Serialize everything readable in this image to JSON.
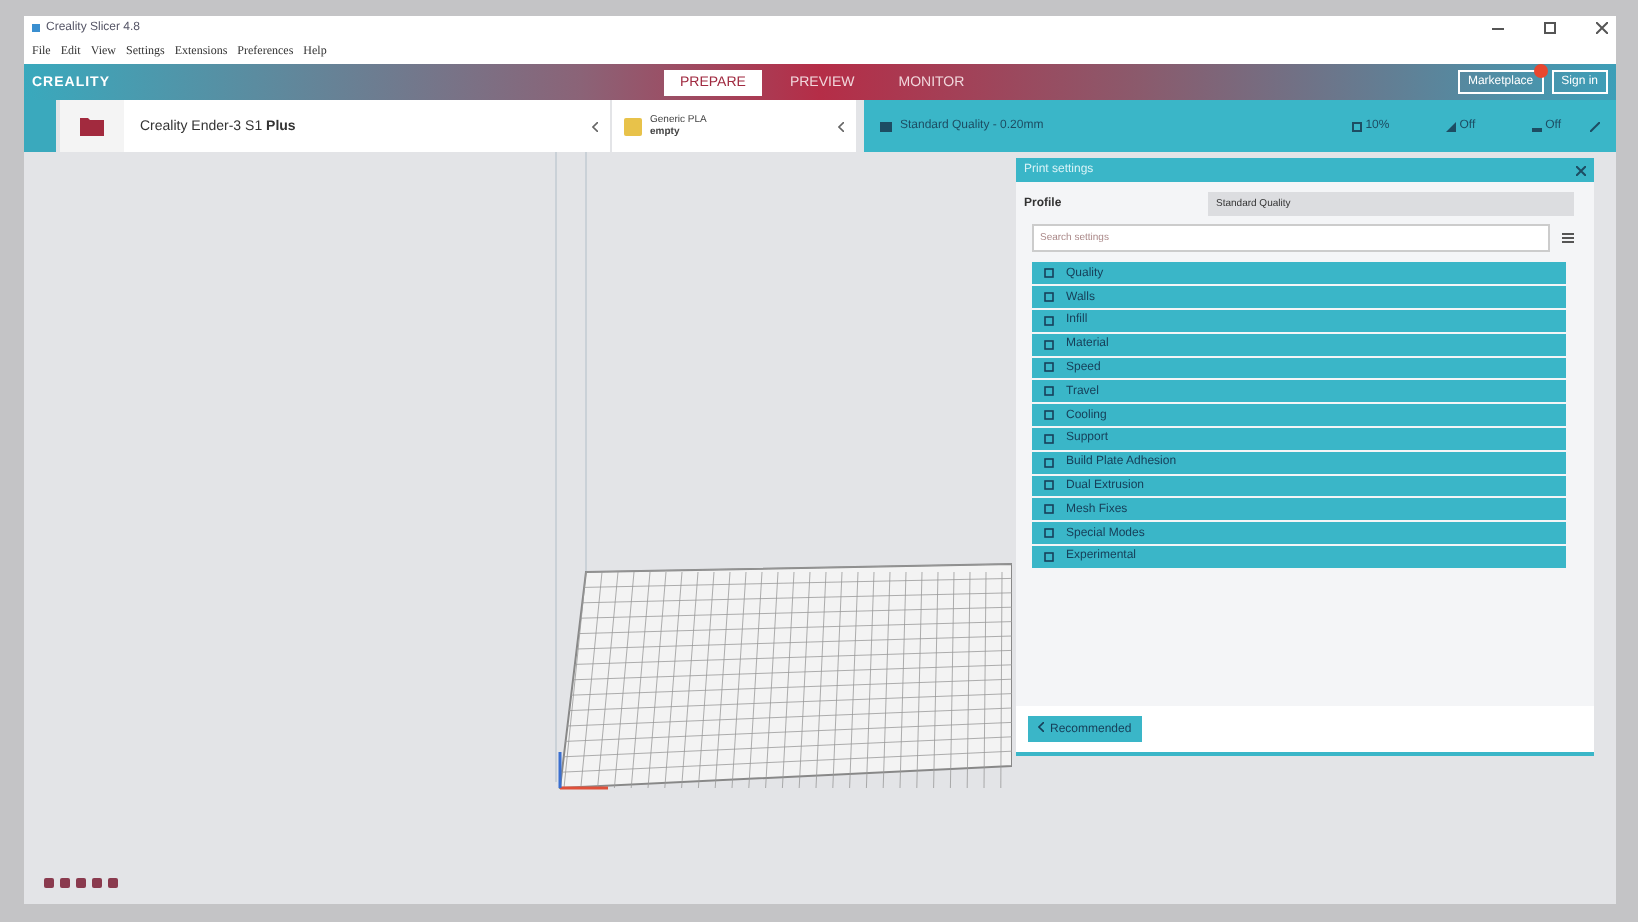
{
  "window": {
    "title": "Creality Slicer 4.8"
  },
  "menu": [
    "File",
    "Edit",
    "View",
    "Settings",
    "Extensions",
    "Preferences",
    "Help"
  ],
  "header": {
    "logo": "CREALITY",
    "stages": [
      {
        "label": "PREPARE",
        "selected": true
      },
      {
        "label": "PREVIEW",
        "selected": false
      },
      {
        "label": "MONITOR",
        "selected": false
      }
    ],
    "buttons": [
      {
        "label": "Marketplace",
        "notification": true
      },
      {
        "label": "Sign in",
        "notification": false
      }
    ]
  },
  "printer": {
    "name": "Creality Ender-3 S1 **Plus**"
  },
  "material": {
    "name": "Generic PLA",
    "status": "empty"
  },
  "profile_bar": {
    "profile": "Standard Quality - 0.20mm",
    "infill": "10%",
    "support": "Off",
    "adhesion": "Off"
  },
  "print_settings": {
    "title": "Print settings",
    "profile_label": "Profile",
    "profile_value": "Standard Quality",
    "search": {
      "placeholder": "Search settings"
    },
    "categories": [
      {
        "label": "Quality"
      },
      {
        "label": "Walls"
      },
      {
        "label": "Infill"
      },
      {
        "label": "Material"
      },
      {
        "label": "Speed"
      },
      {
        "label": "Travel"
      },
      {
        "label": "Cooling"
      },
      {
        "label": "Support"
      },
      {
        "label": "Build Plate Adhesion"
      },
      {
        "label": "Dual Extrusion"
      },
      {
        "label": "Mesh Fixes"
      },
      {
        "label": "Special Modes"
      },
      {
        "label": "Experimental"
      }
    ],
    "mode_button": "Recommended"
  }
}
